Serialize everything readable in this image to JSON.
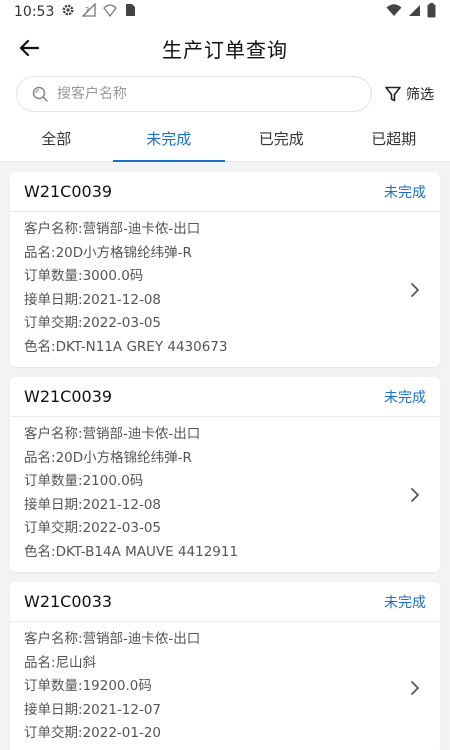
{
  "status_bar": {
    "time": "10:53"
  },
  "header": {
    "title": "生产订单查询"
  },
  "search": {
    "placeholder": "搜客户名称",
    "value": ""
  },
  "filter": {
    "label": "筛选"
  },
  "tabs": [
    {
      "label": "全部"
    },
    {
      "label": "未完成"
    },
    {
      "label": "已完成"
    },
    {
      "label": "已超期"
    }
  ],
  "active_tab": "未完成",
  "colors": {
    "accent": "#1b6fc6"
  },
  "orders": [
    {
      "order_no": "W21C0039",
      "status": "未完成",
      "fields": [
        {
          "label": "客户名称: ",
          "value": "营销部-迪卡侬-出口"
        },
        {
          "label": "品名: ",
          "value": "20D小方格锦纶纬弹-R"
        },
        {
          "label": "订单数量: ",
          "value": "3000.0码"
        },
        {
          "label": "接单日期: ",
          "value": "2021-12-08"
        },
        {
          "label": "订单交期: ",
          "value": "2022-03-05"
        },
        {
          "label": "色名: ",
          "value": "DKT-N11A GREY 4430673"
        }
      ]
    },
    {
      "order_no": "W21C0039",
      "status": "未完成",
      "fields": [
        {
          "label": "客户名称: ",
          "value": "营销部-迪卡侬-出口"
        },
        {
          "label": "品名: ",
          "value": "20D小方格锦纶纬弹-R"
        },
        {
          "label": "订单数量: ",
          "value": "2100.0码"
        },
        {
          "label": "接单日期: ",
          "value": "2021-12-08"
        },
        {
          "label": "订单交期: ",
          "value": "2022-03-05"
        },
        {
          "label": "色名: ",
          "value": "DKT-B14A MAUVE 4412911"
        }
      ]
    },
    {
      "order_no": "W21C0033",
      "status": "未完成",
      "fields": [
        {
          "label": "客户名称: ",
          "value": "营销部-迪卡侬-出口"
        },
        {
          "label": "品名: ",
          "value": "尼山斜"
        },
        {
          "label": "订单数量: ",
          "value": "19200.0码"
        },
        {
          "label": "接单日期: ",
          "value": "2021-12-07"
        },
        {
          "label": "订单交期: ",
          "value": "2022-01-20"
        }
      ]
    }
  ]
}
